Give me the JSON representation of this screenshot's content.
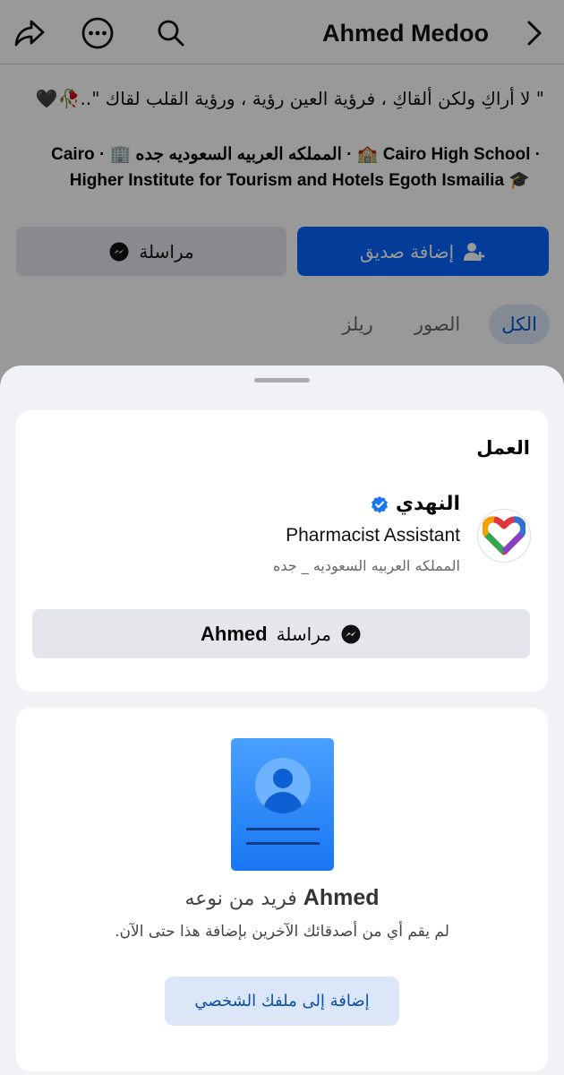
{
  "header": {
    "profile_name": "Ahmed Medoo",
    "icons": [
      "share-icon",
      "more-icon",
      "search-icon",
      "chevron-right-icon"
    ]
  },
  "profile": {
    "bio": "\" لا أراكِ ولكن ألقاكِ ، فرؤية العين رؤية ، ورؤية القلب لقاك \"..🥀🖤",
    "info_line1": "· Cairo High School 🏫 · المملكه العربيه السعوديه جده 🏢 · Cairo",
    "info_line2": "Higher Institute for Tourism and Hotels Egoth Ismailia",
    "add_friend_label": "إضافة صديق",
    "message_label": "مراسلة",
    "tabs": [
      {
        "label": "الكل",
        "active": true
      },
      {
        "label": "الصور",
        "active": false
      },
      {
        "label": "ريلز",
        "active": false
      }
    ]
  },
  "sheet": {
    "work": {
      "heading": "العمل",
      "company": "النهدي",
      "position": "Pharmacist Assistant",
      "location": "المملكه العربيه السعوديه _ جده",
      "message_prefix": "مراسلة",
      "message_name": "Ahmed"
    },
    "unique": {
      "name": "Ahmed",
      "title_suffix": "فريد من نوعه",
      "subtitle": "لم يقم أي من أصدقائك الآخرين بإضافة هذا حتى الآن.",
      "button_label": "إضافة إلى ملفك الشخصي"
    }
  },
  "colors": {
    "primary": "#0866ff",
    "verified": "#1877f2",
    "sheet_bg": "#f0f2f5",
    "secondary_button": "#e4e6eb",
    "light_blue_button": "#dbe7f8"
  }
}
